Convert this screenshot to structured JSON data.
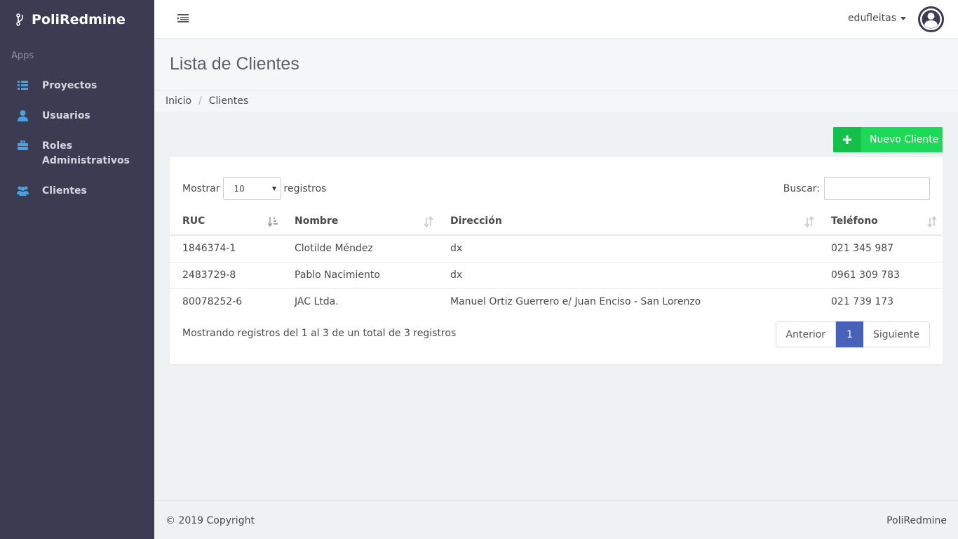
{
  "sidebar": {
    "brand": "PoliRedmine",
    "section_label": "Apps",
    "items": [
      {
        "label": "Proyectos",
        "icon": "list-icon"
      },
      {
        "label": "Usuarios",
        "icon": "user-icon"
      },
      {
        "label": "Roles Administrativos",
        "icon": "briefcase-icon"
      },
      {
        "label": "Clientes",
        "icon": "users-icon"
      }
    ]
  },
  "topbar": {
    "username": "edufleitas"
  },
  "page": {
    "title": "Lista de Clientes",
    "breadcrumb": [
      "Inicio",
      "Clientes"
    ],
    "new_button": "Nuevo Cliente"
  },
  "table_controls": {
    "show_label": "Mostrar",
    "show_value": "10",
    "records_label": "registros",
    "search_label": "Buscar:",
    "search_placeholder": ""
  },
  "table": {
    "headers": [
      "RUC",
      "Nombre",
      "Dirección",
      "Teléfono"
    ],
    "rows": [
      [
        "1846374-1",
        "Clotilde Méndez",
        "dx",
        "021 345 987"
      ],
      [
        "2483729-8",
        "Pablo Nacimiento",
        "dx",
        "0961 309 783"
      ],
      [
        "80078252-6",
        "JAC Ltda.",
        "Manuel Ortiz Guerrero e/ Juan Enciso - San Lorenzo",
        "021 739 173"
      ]
    ]
  },
  "pagination": {
    "info": "Mostrando registros del 1 al 3 de un total de 3 registros",
    "prev": "Anterior",
    "current": "1",
    "next": "Siguiente"
  },
  "footer": {
    "copyright": "© 2019 Copyright",
    "brand": "PoliRedmine"
  },
  "colors": {
    "sidebar_bg": "#3c3b52",
    "accent_blue": "#4aa3e0",
    "success_green": "#1dd957",
    "pager_active": "#4862b9"
  }
}
